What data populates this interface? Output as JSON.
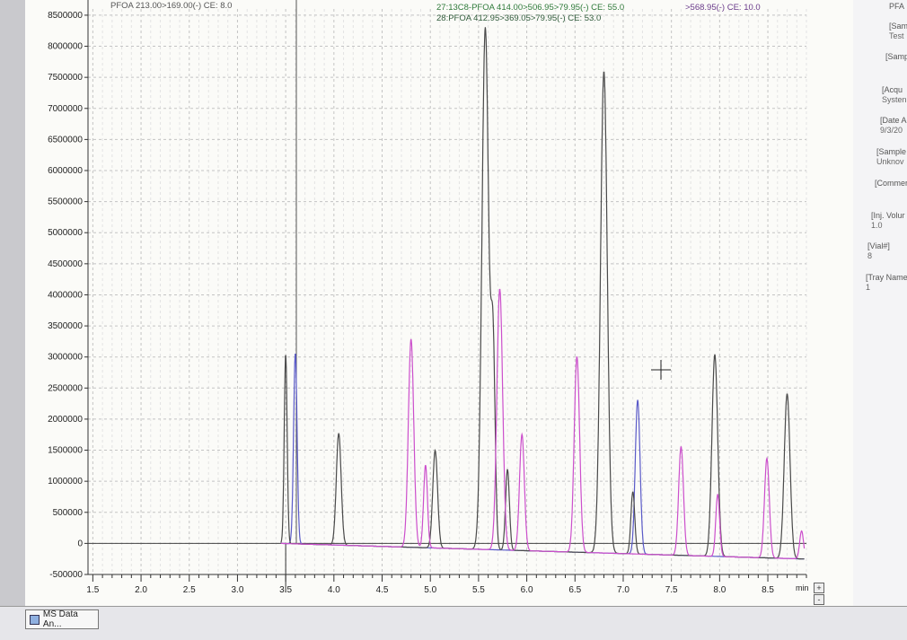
{
  "chart_data": {
    "type": "line",
    "xlabel": "min",
    "ylabel": "",
    "xlim": [
      1.45,
      8.9
    ],
    "ylim": [
      -500000,
      8600000
    ],
    "x_ticks": [
      1.5,
      2.0,
      2.5,
      3.0,
      3.5,
      4.0,
      4.5,
      5.0,
      5.5,
      6.0,
      6.5,
      7.0,
      7.5,
      8.0,
      8.5
    ],
    "x_tick_labels": [
      "1.5",
      "2.0",
      "2.5",
      "3.0",
      "3.5",
      "4.0",
      "4.5",
      "5.0",
      "5.5",
      "6.0",
      "6.5",
      "7.0",
      "7.5",
      "8.0",
      "8.5"
    ],
    "y_ticks": [
      -500000,
      0,
      500000,
      1000000,
      1500000,
      2000000,
      2500000,
      3000000,
      3500000,
      4000000,
      4500000,
      5000000,
      5500000,
      6000000,
      6500000,
      7000000,
      7500000,
      8000000,
      8500000
    ],
    "y_tick_labels": [
      "-500000",
      "0",
      "500000",
      "1000000",
      "1500000",
      "2000000",
      "2500000",
      "3000000",
      "3500000",
      "4000000",
      "4500000",
      "5000000",
      "5500000",
      "6000000",
      "6500000",
      "7000000",
      "7500000",
      "8000000",
      "8500000"
    ],
    "grid": true,
    "annotations": [
      {
        "text": "PFOA 213.00>169.00(-) CE: 8.0",
        "color": "#555555"
      },
      {
        "text": "27:13C8-PFOA 414.00>506.95>79.95(-) CE: 55.0",
        "color": "#2f7a3a"
      },
      {
        "text": "28:PFOA 412.95>369.05>79.95(-) CE: 53.0",
        "color": "#2f5a3a"
      },
      {
        "text": ">568.95(-) CE: 10.0",
        "color": "#6a3a8a"
      }
    ],
    "series": [
      {
        "color": "#5a5ac8",
        "peaks": [
          [
            3.6,
            3070000,
            0.018
          ],
          [
            7.15,
            2480000,
            0.025
          ]
        ]
      },
      {
        "color": "#4a4a4a",
        "peaks": [
          [
            3.5,
            3050000,
            0.015
          ],
          [
            4.05,
            1800000,
            0.025
          ],
          [
            5.05,
            1570000,
            0.025
          ],
          [
            5.57,
            8400000,
            0.035
          ],
          [
            5.65,
            3180000,
            0.022
          ],
          [
            5.8,
            1300000,
            0.02
          ],
          [
            6.8,
            7750000,
            0.035
          ],
          [
            7.1,
            1000000,
            0.02
          ],
          [
            7.95,
            3250000,
            0.03
          ],
          [
            8.7,
            2650000,
            0.03
          ]
        ]
      },
      {
        "color": "#cc4fcc",
        "peaks": [
          [
            4.8,
            3350000,
            0.028
          ],
          [
            4.95,
            1330000,
            0.02
          ],
          [
            5.72,
            4200000,
            0.03
          ],
          [
            5.95,
            1870000,
            0.025
          ],
          [
            6.52,
            3150000,
            0.028
          ],
          [
            7.6,
            1750000,
            0.025
          ],
          [
            7.98,
            1000000,
            0.02
          ],
          [
            8.49,
            1600000,
            0.025
          ],
          [
            8.85,
            450000,
            0.02
          ]
        ]
      }
    ]
  },
  "side_panel": {
    "items": [
      {
        "label": "PFA",
        "value": ""
      },
      {
        "label": "[Sam",
        "value": "Test"
      },
      {
        "label": "[Samp",
        "value": ""
      },
      {
        "label": "[Acqu",
        "value": "Systen"
      },
      {
        "label": "[Date A",
        "value": "9/3/20"
      },
      {
        "label": "[Sample",
        "value": "Unknov"
      },
      {
        "label": "[Commer",
        "value": ""
      },
      {
        "label": "[Inj. Volur",
        "value": "1.0"
      },
      {
        "label": "[Vial#]",
        "value": "8"
      },
      {
        "label": "[Tray Name",
        "value": "1"
      }
    ]
  },
  "taskbar": {
    "button_label": "MS Data An..."
  },
  "zoom": {
    "in": "+",
    "out": "-"
  }
}
